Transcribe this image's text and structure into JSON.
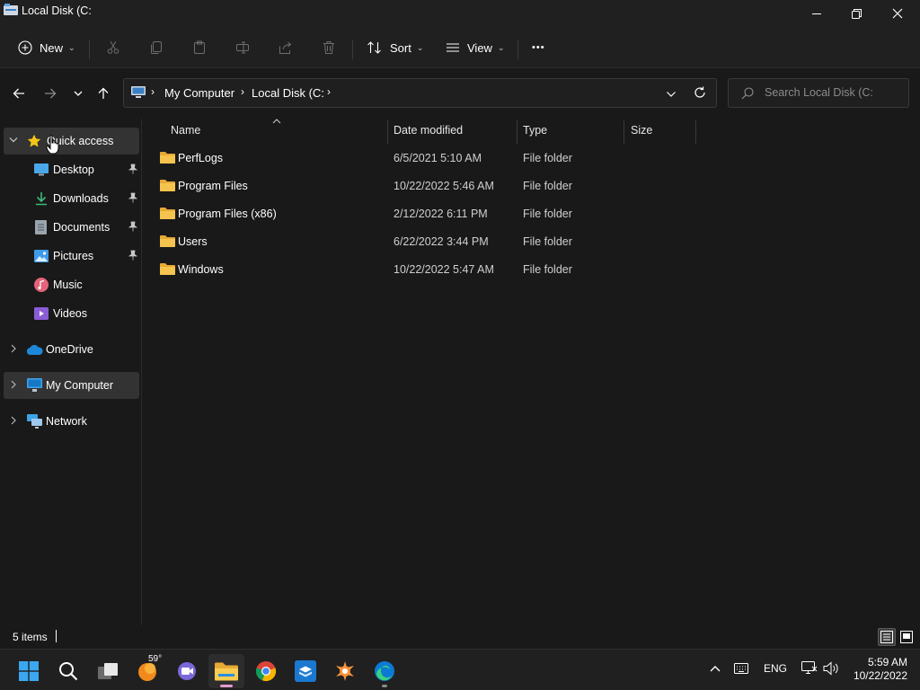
{
  "window": {
    "title": "Local Disk (C:"
  },
  "toolbar": {
    "new_label": "New",
    "sort_label": "Sort",
    "view_label": "View",
    "more_label": "•••"
  },
  "address": {
    "crumbs": [
      "My Computer",
      "Local Disk (C:"
    ],
    "search_placeholder": "Search Local Disk (C:"
  },
  "sidebar": {
    "quick_access": "Quick access",
    "items": [
      {
        "label": "Desktop",
        "icon": "desktop-icon",
        "pinned": true
      },
      {
        "label": "Downloads",
        "icon": "downloads-icon",
        "pinned": true
      },
      {
        "label": "Documents",
        "icon": "documents-icon",
        "pinned": true
      },
      {
        "label": "Pictures",
        "icon": "pictures-icon",
        "pinned": true
      },
      {
        "label": "Music",
        "icon": "music-icon",
        "pinned": false
      },
      {
        "label": "Videos",
        "icon": "videos-icon",
        "pinned": false
      }
    ],
    "onedrive": "OneDrive",
    "my_computer": "My Computer",
    "network": "Network"
  },
  "columns": {
    "name": "Name",
    "date": "Date modified",
    "type": "Type",
    "size": "Size"
  },
  "files": [
    {
      "name": "PerfLogs",
      "date": "6/5/2021 5:10 AM",
      "type": "File folder"
    },
    {
      "name": "Program Files",
      "date": "10/22/2022 5:46 AM",
      "type": "File folder"
    },
    {
      "name": "Program Files (x86)",
      "date": "2/12/2022 6:11 PM",
      "type": "File folder"
    },
    {
      "name": "Users",
      "date": "6/22/2022 3:44 PM",
      "type": "File folder"
    },
    {
      "name": "Windows",
      "date": "10/22/2022 5:47 AM",
      "type": "File folder"
    }
  ],
  "status": {
    "item_count": "5 items"
  },
  "taskbar": {
    "weather_temp": "59°",
    "language": "ENG",
    "time": "5:59 AM",
    "date": "10/22/2022"
  },
  "colors": {
    "folder": "#f4c44e",
    "accent": "#0a84d6",
    "background": "#191919",
    "chrome": "#202020"
  }
}
